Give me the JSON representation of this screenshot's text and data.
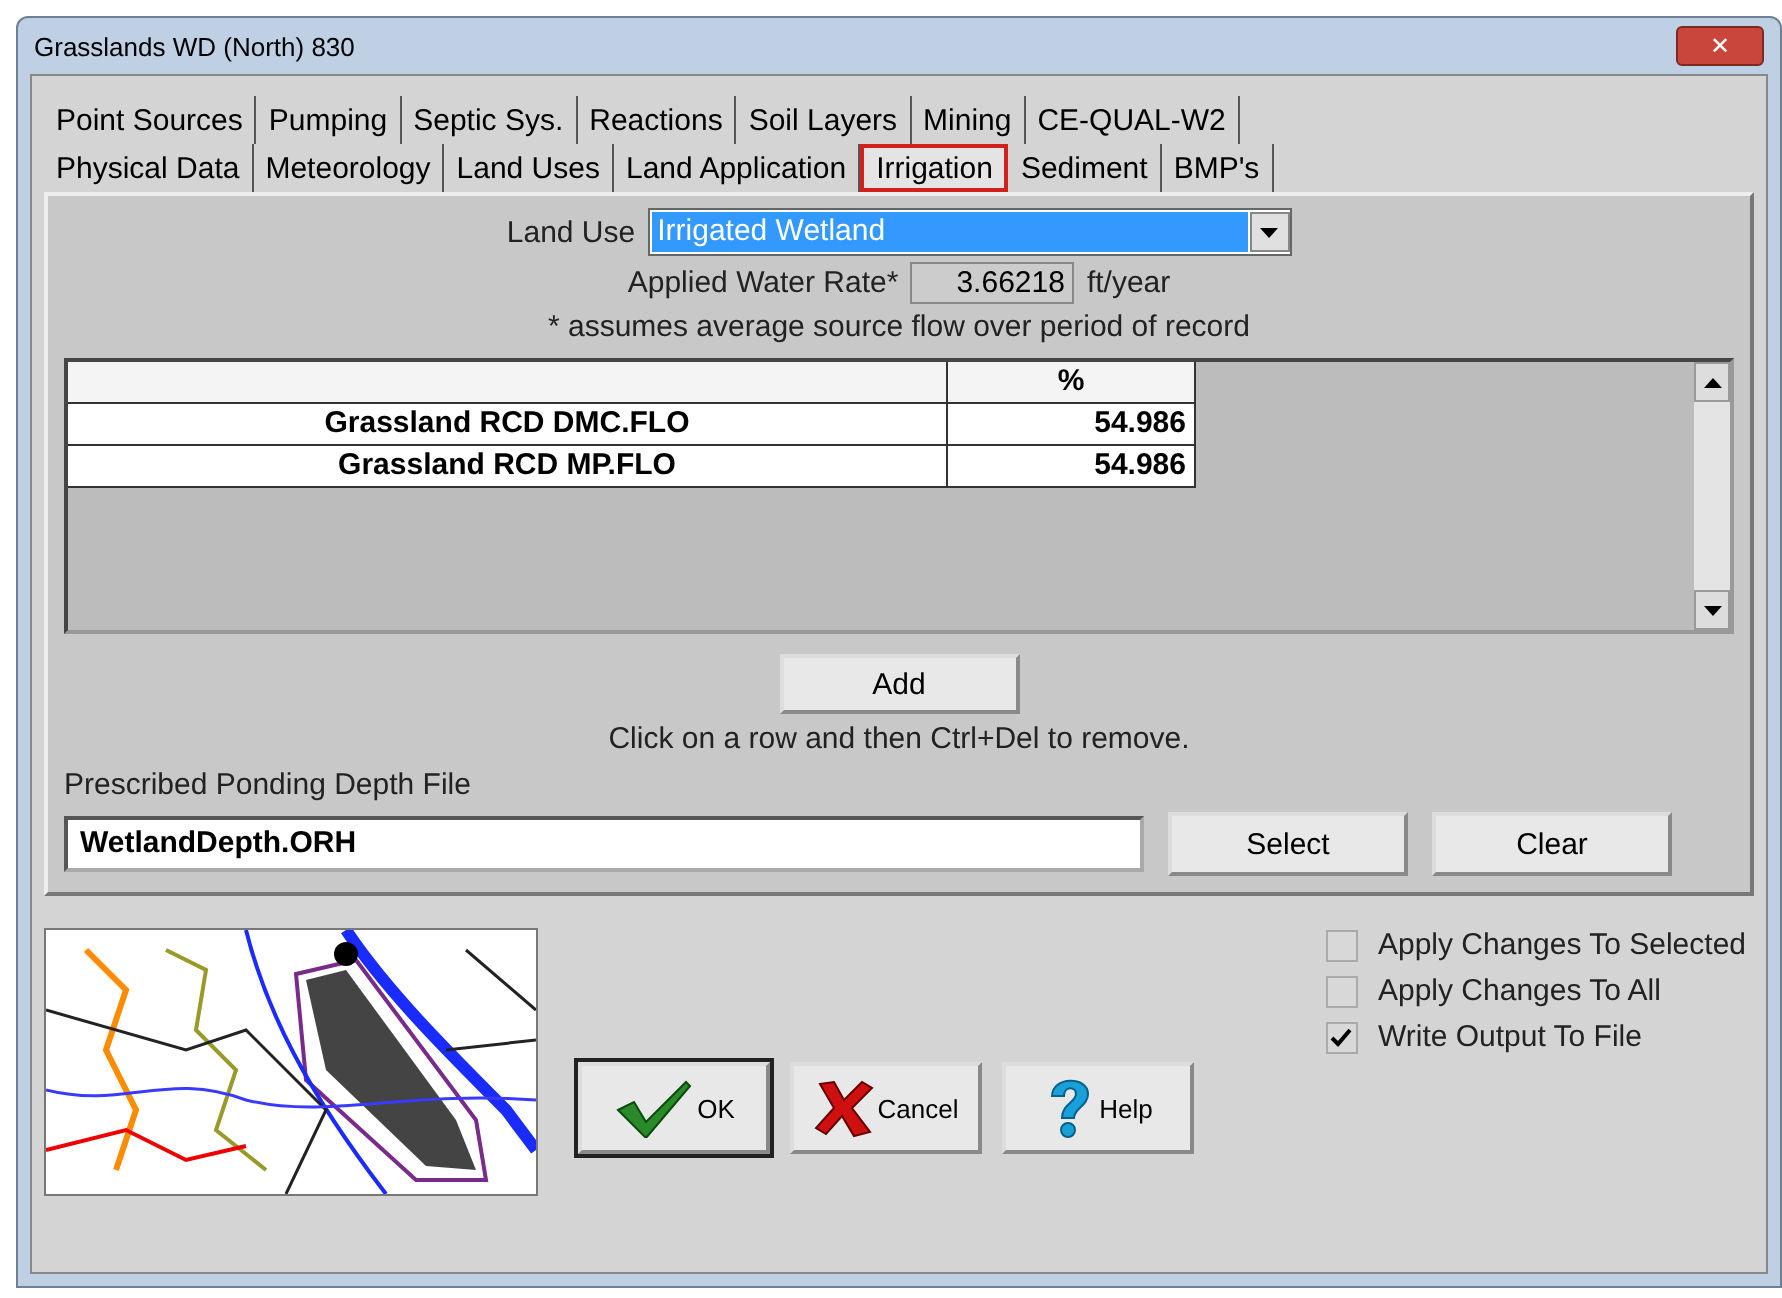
{
  "window": {
    "title": "Grasslands WD (North) 830",
    "close": "✕"
  },
  "tab_rows": [
    {
      "tabs": [
        {
          "label": "Point Sources",
          "selected": false
        },
        {
          "label": "Pumping",
          "selected": false
        },
        {
          "label": "Septic Sys.",
          "selected": false
        },
        {
          "label": "Reactions",
          "selected": false
        },
        {
          "label": "Soil Layers",
          "selected": false
        },
        {
          "label": "Mining",
          "selected": false
        },
        {
          "label": "CE-QUAL-W2",
          "selected": false
        }
      ]
    },
    {
      "tabs": [
        {
          "label": "Physical Data",
          "selected": false
        },
        {
          "label": "Meteorology",
          "selected": false
        },
        {
          "label": "Land Uses",
          "selected": false
        },
        {
          "label": "Land Application",
          "selected": false
        },
        {
          "label": "Irrigation",
          "selected": true
        },
        {
          "label": "Sediment",
          "selected": false
        },
        {
          "label": "BMP's",
          "selected": false
        }
      ]
    }
  ],
  "land_use": {
    "label": "Land Use",
    "value": "Irrigated Wetland"
  },
  "applied_water_rate": {
    "label": "Applied Water Rate*",
    "value": "3.66218",
    "unit": "ft/year"
  },
  "footnote": "* assumes average source flow over period of record",
  "table": {
    "columns": [
      "",
      "%"
    ],
    "rows": [
      {
        "cells": [
          "Grassland RCD DMC.FLO",
          "54.986"
        ]
      },
      {
        "cells": [
          "Grassland RCD MP.FLO",
          "54.986"
        ]
      }
    ]
  },
  "add_button": "Add",
  "hint": "Click on a row and then Ctrl+Del to remove.",
  "ponding_file": {
    "label": "Prescribed Ponding Depth File",
    "value": "WetlandDepth.ORH",
    "buttons": [
      "Select",
      "Clear"
    ]
  },
  "options": [
    {
      "label": "Apply Changes To Selected",
      "checked": false
    },
    {
      "label": "Apply Changes To All",
      "checked": false
    },
    {
      "label": "Write Output To File",
      "checked": true
    }
  ],
  "buttons": [
    {
      "kind": "ok",
      "label": "OK"
    },
    {
      "kind": "cancel",
      "label": "Cancel"
    },
    {
      "kind": "help",
      "label": "Help"
    }
  ]
}
